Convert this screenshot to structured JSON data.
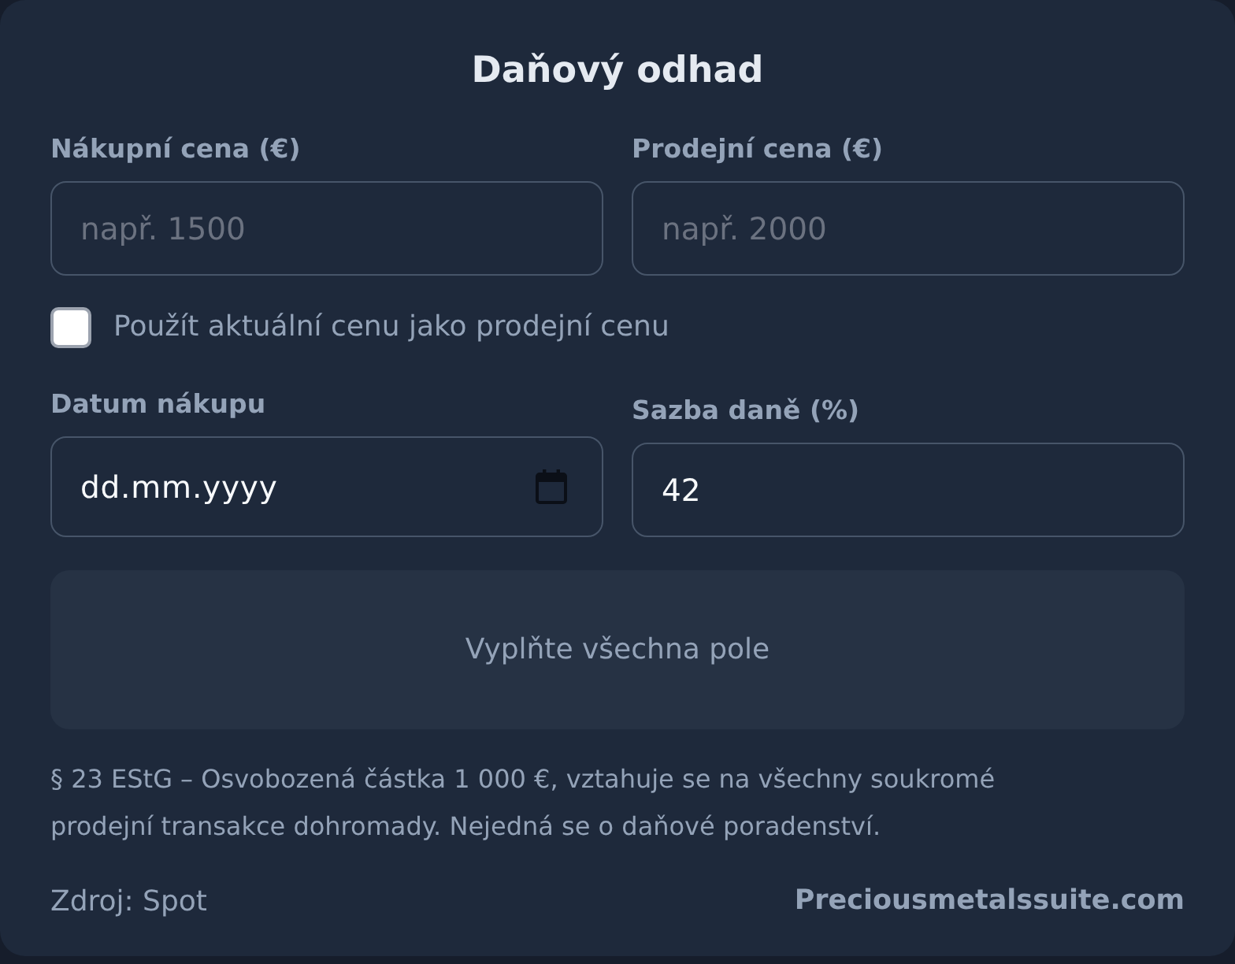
{
  "title": "Daňový odhad",
  "price_fields": [
    {
      "label": "Nákupní cena (€)",
      "kind": "number",
      "placeholder": "např. 1500"
    },
    {
      "label": "Prodejní cena (€)",
      "kind": "number",
      "placeholder": "např. 2000"
    }
  ],
  "use_current_price": {
    "label": "Použít aktuální cenu jako prodejní cenu",
    "checked": false
  },
  "detail_fields": [
    {
      "label": "Datum nákupu",
      "kind": "date",
      "placeholder": "dd.mm.yyyy"
    },
    {
      "label": "Sazba daně (%)",
      "kind": "number",
      "value": "42"
    }
  ],
  "result": {
    "message": "Vyplňte všechna pole"
  },
  "note": "§ 23 EStG – Osvobozená částka 1 000 €, vztahuje se na všechny soukromé prodejní transakce dohromady. Nejedná se o daňové poradenství.",
  "footer": {
    "source": "Zdroj: Spot",
    "link": "Preciousmetalssuite.com"
  }
}
